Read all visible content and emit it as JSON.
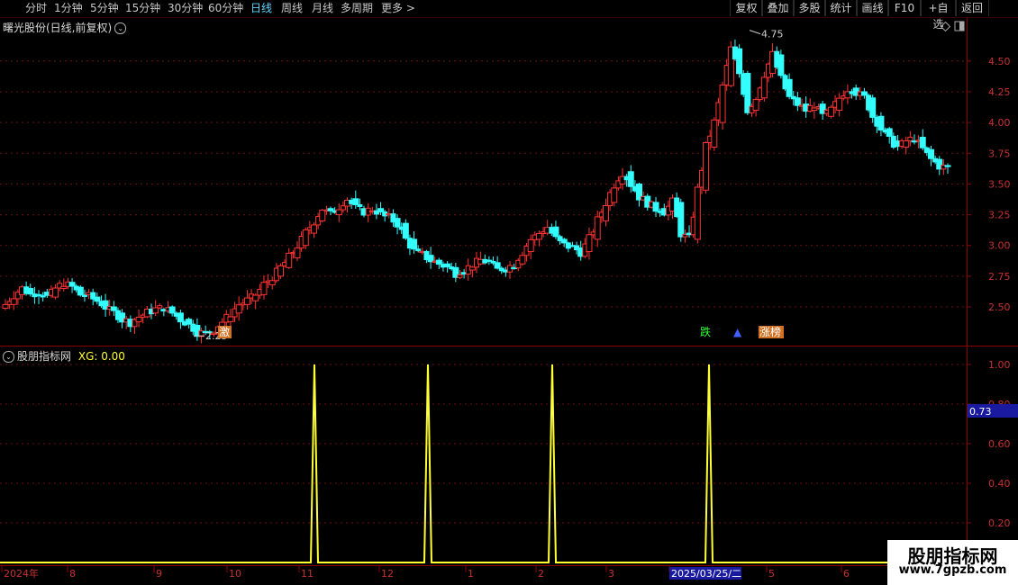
{
  "toolbar": {
    "periods": [
      "分时",
      "1分钟",
      "5分钟",
      "15分钟",
      "30分钟",
      "60分钟",
      "日线",
      "周线",
      "月线",
      "多周期",
      "更多 >"
    ],
    "active_period": "日线",
    "right_buttons": [
      "复权",
      "叠加",
      "多股",
      "统计",
      "画线",
      "F10",
      "+自选",
      "返回"
    ]
  },
  "stock": {
    "title": "曙光股份(日线,前复权)",
    "low_label": "2.25",
    "high_label": "4.75",
    "markers": [
      {
        "text": "激",
        "bg": "#d07020",
        "color": "#ffffff"
      },
      {
        "text": "跌",
        "bg": "#000000",
        "color": "#33ff33"
      },
      {
        "text": "▲",
        "bg": "#000000",
        "color": "#4060ff"
      },
      {
        "text": "涨榜",
        "bg": "#d07020",
        "color": "#ffffff"
      }
    ],
    "icons": [
      "diamond-icon",
      "panel-toggle-icon"
    ]
  },
  "indicator": {
    "name": "股朋指标网",
    "xg_label": "XG: 0.00",
    "current_value": "0.73",
    "axis_ticks": [
      "1.00",
      "0.80",
      "0.60",
      "0.40",
      "0.20"
    ]
  },
  "chart_data": [
    {
      "type": "candlestick",
      "title": "曙光股份(日线,前复权)",
      "y_ticks": [
        2.5,
        2.75,
        3.0,
        3.25,
        3.5,
        3.75,
        4.0,
        4.25,
        4.5
      ],
      "ylim": [
        2.2,
        4.85
      ],
      "grid": true,
      "up_color": "#ff3333",
      "down_color": "#33ffff",
      "annotations": [
        {
          "text": "2.25",
          "value": 2.25
        },
        {
          "text": "4.75",
          "value": 4.75
        }
      ],
      "close_path": [
        2.52,
        2.6,
        2.65,
        2.6,
        2.62,
        2.58,
        2.65,
        2.7,
        2.66,
        2.6,
        2.58,
        2.55,
        2.5,
        2.45,
        2.4,
        2.38,
        2.42,
        2.45,
        2.48,
        2.5,
        2.45,
        2.4,
        2.35,
        2.3,
        2.28,
        2.32,
        2.38,
        2.45,
        2.52,
        2.55,
        2.6,
        2.68,
        2.75,
        2.82,
        2.9,
        3.0,
        3.1,
        3.2,
        3.3,
        3.25,
        3.32,
        3.38,
        3.3,
        3.28,
        3.3,
        3.25,
        3.22,
        3.18,
        3.05,
        2.95,
        2.92,
        2.88,
        2.85,
        2.82,
        2.78,
        2.8,
        2.85,
        2.88,
        2.86,
        2.8,
        2.82,
        2.85,
        2.95,
        3.05,
        3.1,
        3.15,
        3.05,
        3.0,
        2.98,
        2.95,
        3.05,
        3.2,
        3.35,
        3.5,
        3.6,
        3.5,
        3.4,
        3.35,
        3.3,
        3.28,
        3.35,
        3.1,
        3.05,
        3.45,
        3.8,
        4.0,
        4.3,
        4.6,
        4.4,
        4.1,
        4.2,
        4.4,
        4.55,
        4.35,
        4.2,
        4.15,
        4.1,
        4.15,
        4.05,
        4.1,
        4.2,
        4.28,
        4.25,
        4.2,
        4.05,
        3.95,
        3.85,
        3.8,
        3.85,
        3.88,
        3.78,
        3.7,
        3.65,
        3.63
      ]
    },
    {
      "type": "line",
      "series": [
        {
          "name": "XG",
          "color": "#ffff33"
        }
      ],
      "ylim": [
        0,
        1.0
      ],
      "y_ticks": [
        1.0,
        0.8,
        0.6,
        0.4,
        0.2
      ],
      "spikes": [
        {
          "date": "2024-11",
          "value": 1.0
        },
        {
          "date": "2024-12",
          "value": 1.0
        },
        {
          "date": "2025-02",
          "value": 1.0
        },
        {
          "date": "2025-03-25",
          "value": 1.0
        }
      ],
      "baseline": 0.0
    }
  ],
  "time_axis": {
    "labels": [
      "2024年",
      "8",
      "9",
      "10",
      "11",
      "12",
      "1",
      "2",
      "3",
      "2025/03/25/二",
      "5",
      "6"
    ],
    "highlight": "2025/03/25/二"
  },
  "watermark": {
    "line1": "股朋指标网",
    "line2": "www.7gpzb.com"
  }
}
